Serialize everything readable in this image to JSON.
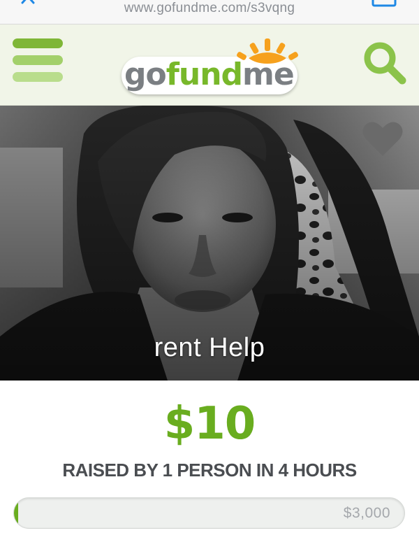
{
  "browser": {
    "url": "www.gofundme.com/s3vqng"
  },
  "header": {
    "logo": "gofundme",
    "logo_parts": [
      "go",
      "fund",
      "me"
    ],
    "menu_icon": "hamburger-menu-icon",
    "search_icon": "search-icon",
    "brand_color": "#78b82a"
  },
  "campaign": {
    "title": "rent Help",
    "favorite_icon": "heart-icon",
    "raised_amount": "$10",
    "raised_summary": "RAISED BY 1 PERSON IN 4 HOURS",
    "goal": "$3,000",
    "progress_fraction": 0.0033
  }
}
